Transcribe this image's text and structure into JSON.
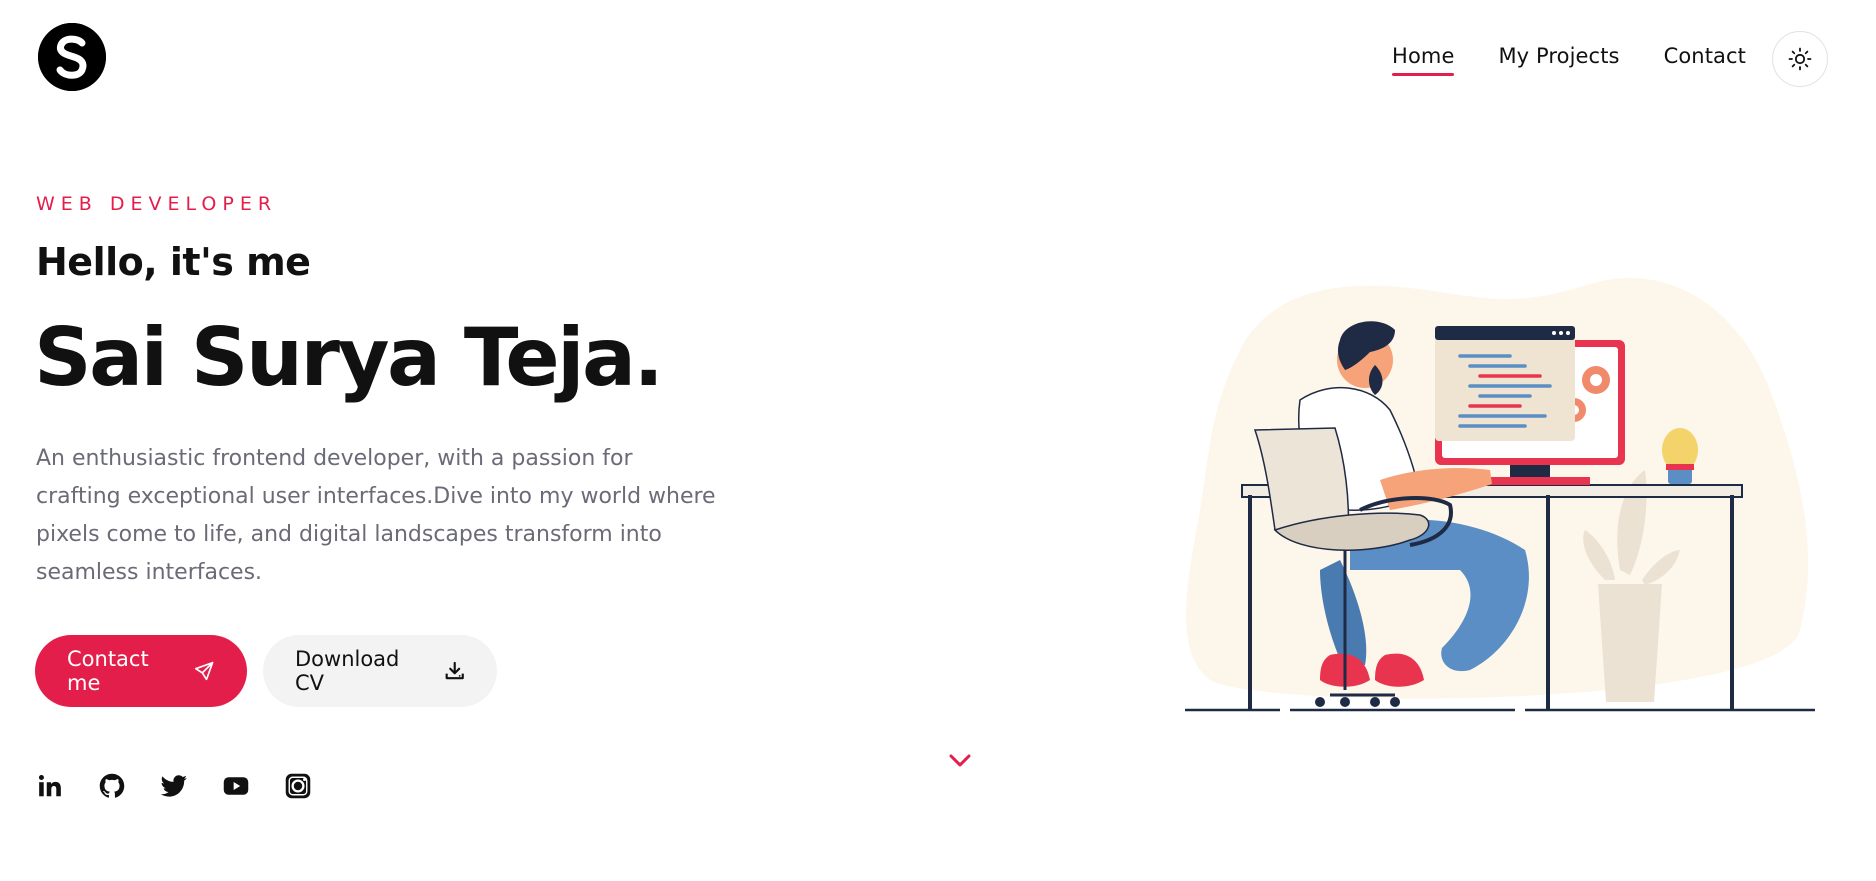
{
  "header": {
    "logo_letter": "S",
    "nav": [
      {
        "label": "Home",
        "active": true
      },
      {
        "label": "My Projects",
        "active": false
      },
      {
        "label": "Contact",
        "active": false
      }
    ],
    "theme_toggle_icon": "sun-icon"
  },
  "hero": {
    "kicker": "WEB DEVELOPER",
    "greeting": "Hello, it's me",
    "name": "Sai Surya Teja.",
    "description": "An enthusiastic frontend developer, with a passion for crafting exceptional user interfaces.Dive into my world where pixels come to life, and digital landscapes transform into seamless interfaces.",
    "buttons": {
      "contact_label": "Contact me",
      "contact_icon": "paper-plane-icon",
      "download_label": "Download CV",
      "download_icon": "download-icon"
    }
  },
  "socials": [
    "linkedin-icon",
    "github-icon",
    "twitter-icon",
    "youtube-icon",
    "instagram-icon"
  ],
  "scroll_icon": "chevron-down-icon",
  "colors": {
    "accent": "#e41e4a",
    "text": "#111111",
    "muted": "#6b6b78",
    "blob": "#fdf6ea"
  }
}
